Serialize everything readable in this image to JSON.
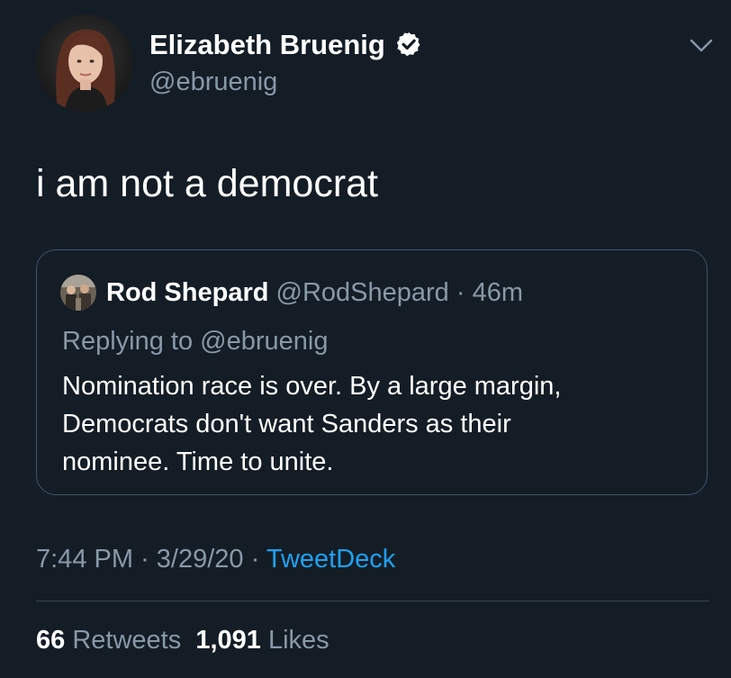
{
  "tweet": {
    "author": {
      "display_name": "Elizabeth Bruenig",
      "handle": "@ebruenig",
      "verified": true
    },
    "text": "i am not a democrat",
    "menu_icon": "chevron-down-icon"
  },
  "quoted_tweet": {
    "display_name": "Rod Shepard",
    "handle": "@RodShepard",
    "separator": "·",
    "age": "46m",
    "replying_to_prefix": "Replying to ",
    "replying_to_handle": "@ebruenig",
    "text_lines": [
      "Nomination race is over. By a large margin,",
      "Democrats don't want Sanders as their",
      "nominee. Time to unite."
    ]
  },
  "meta": {
    "time": "7:44 PM",
    "date": "3/29/20",
    "separator": "·",
    "source": "TweetDeck"
  },
  "stats": {
    "retweets_count": "66",
    "retweets_label": "Retweets",
    "likes_count": "1,091",
    "likes_label": "Likes"
  },
  "colors": {
    "background": "#141d26",
    "text_primary": "#ffffff",
    "text_secondary": "#8899a6",
    "link": "#1da1f2",
    "quote_border": "#3d5466",
    "divider": "#38444d"
  }
}
